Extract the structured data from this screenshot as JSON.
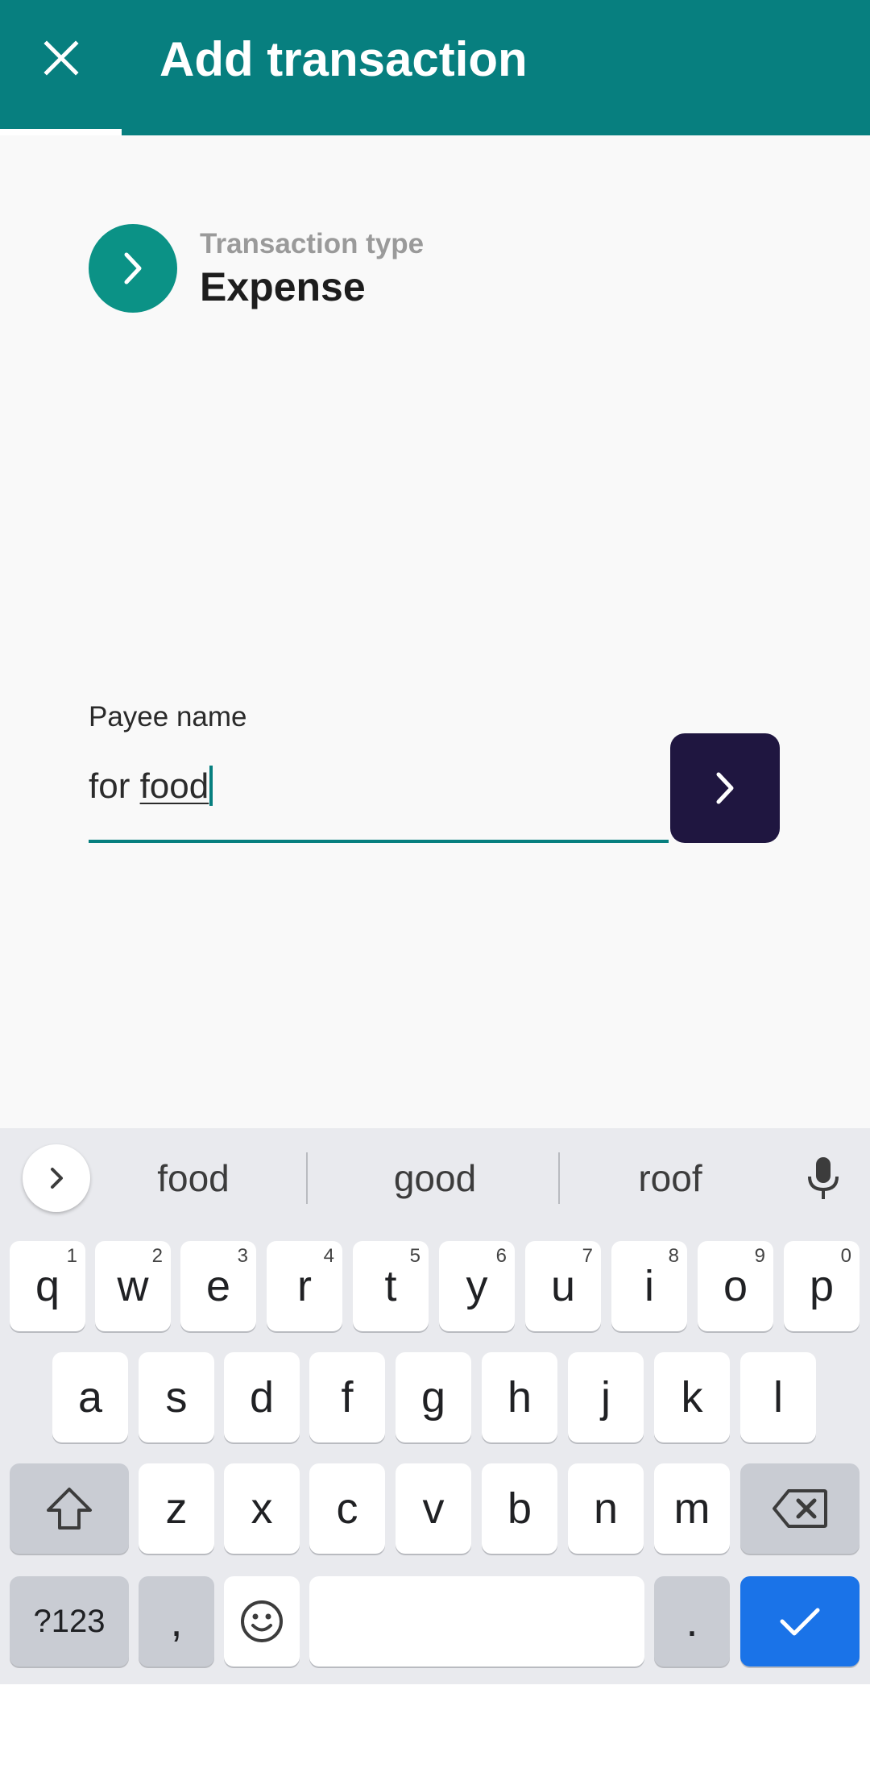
{
  "app_bar": {
    "title": "Add transaction",
    "close_icon": "close-icon",
    "progress": 0.14,
    "color": "#077f7f"
  },
  "transaction_type": {
    "label": "Transaction type",
    "value": "Expense",
    "icon": "chevron-right-icon",
    "color": "#0b9286"
  },
  "payee": {
    "label": "Payee name",
    "value_prefix": "for ",
    "value_composing": "food",
    "next_icon": "chevron-right-icon",
    "next_button_color": "#1f1640"
  },
  "keyboard": {
    "suggestions": [
      "food",
      "good",
      "roof"
    ],
    "row1": [
      {
        "key": "q",
        "hint": "1"
      },
      {
        "key": "w",
        "hint": "2"
      },
      {
        "key": "e",
        "hint": "3"
      },
      {
        "key": "r",
        "hint": "4"
      },
      {
        "key": "t",
        "hint": "5"
      },
      {
        "key": "y",
        "hint": "6"
      },
      {
        "key": "u",
        "hint": "7"
      },
      {
        "key": "i",
        "hint": "8"
      },
      {
        "key": "o",
        "hint": "9"
      },
      {
        "key": "p",
        "hint": "0"
      }
    ],
    "row2": [
      "a",
      "s",
      "d",
      "f",
      "g",
      "h",
      "j",
      "k",
      "l"
    ],
    "row3": [
      "z",
      "x",
      "c",
      "v",
      "b",
      "n",
      "m"
    ],
    "row4": {
      "symbols": "?123",
      "comma": ",",
      "period": "."
    },
    "icons": {
      "expand": "chevron-right-icon",
      "mic": "mic-icon",
      "shift": "shift-icon",
      "backspace": "backspace-icon",
      "emoji": "emoji-icon",
      "enter": "check-icon"
    },
    "accent": "#1a73e8"
  }
}
